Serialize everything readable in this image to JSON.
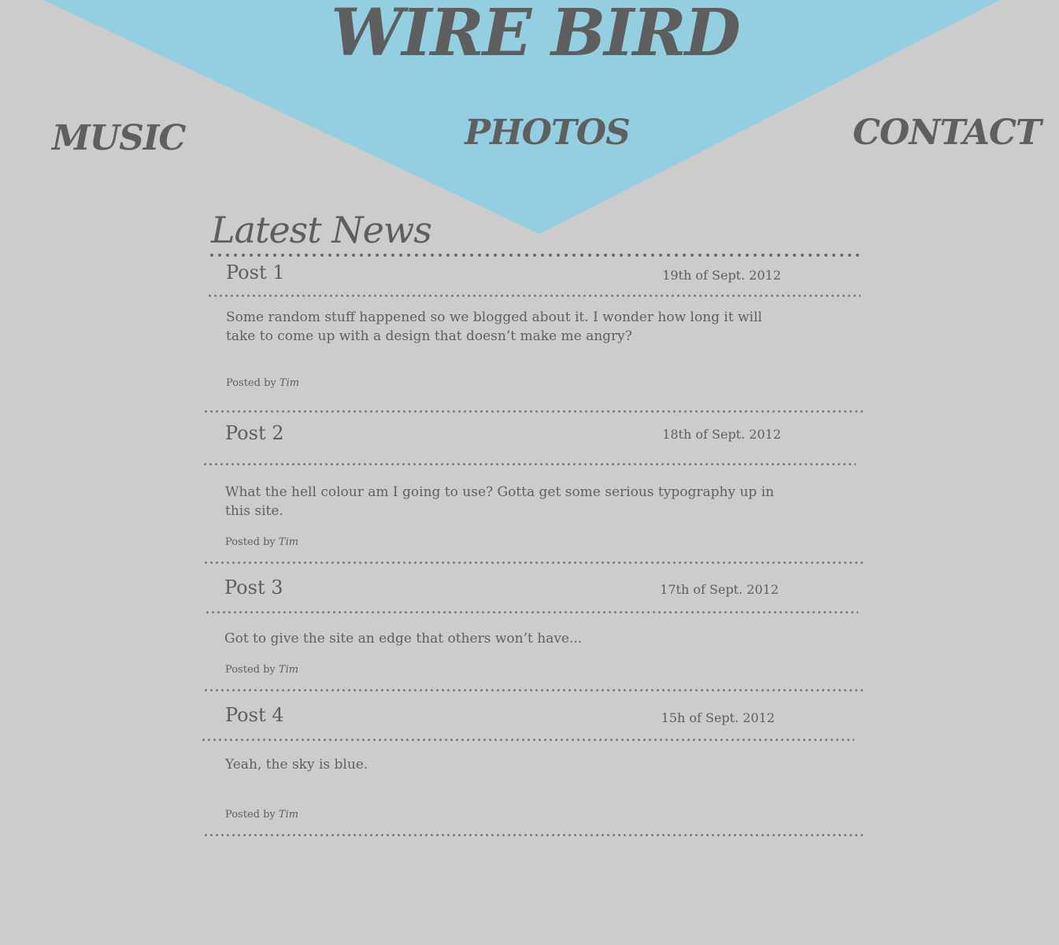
{
  "colors": {
    "background": "#cccccc",
    "banner": "#93cfe0",
    "text": "#5f5f5f"
  },
  "header": {
    "site_title": "WIRE BIRD",
    "nav": [
      {
        "label": "MUSIC"
      },
      {
        "label": "PHOTOS"
      },
      {
        "label": "CONTACT"
      }
    ]
  },
  "news": {
    "heading": "Latest News",
    "posted_by_label": "Posted by",
    "posts": [
      {
        "title": "Post 1",
        "date": "19th of Sept. 2012",
        "body": "Some random stuff happened so we blogged about it. I wonder how long it will take to come up with a design that doesn’t make me angry?",
        "author": "Tim"
      },
      {
        "title": "Post 2",
        "date": "18th of Sept. 2012",
        "body": "What the hell colour am I going to use? Gotta get some serious typography up in this site.",
        "author": "Tim"
      },
      {
        "title": "Post 3",
        "date": "17th of Sept. 2012",
        "body": "Got to give the site an edge that others won’t have...",
        "author": "Tim"
      },
      {
        "title": "Post 4",
        "date": "15h of Sept. 2012",
        "body": "Yeah, the sky is blue.",
        "author": "Tim"
      }
    ]
  }
}
